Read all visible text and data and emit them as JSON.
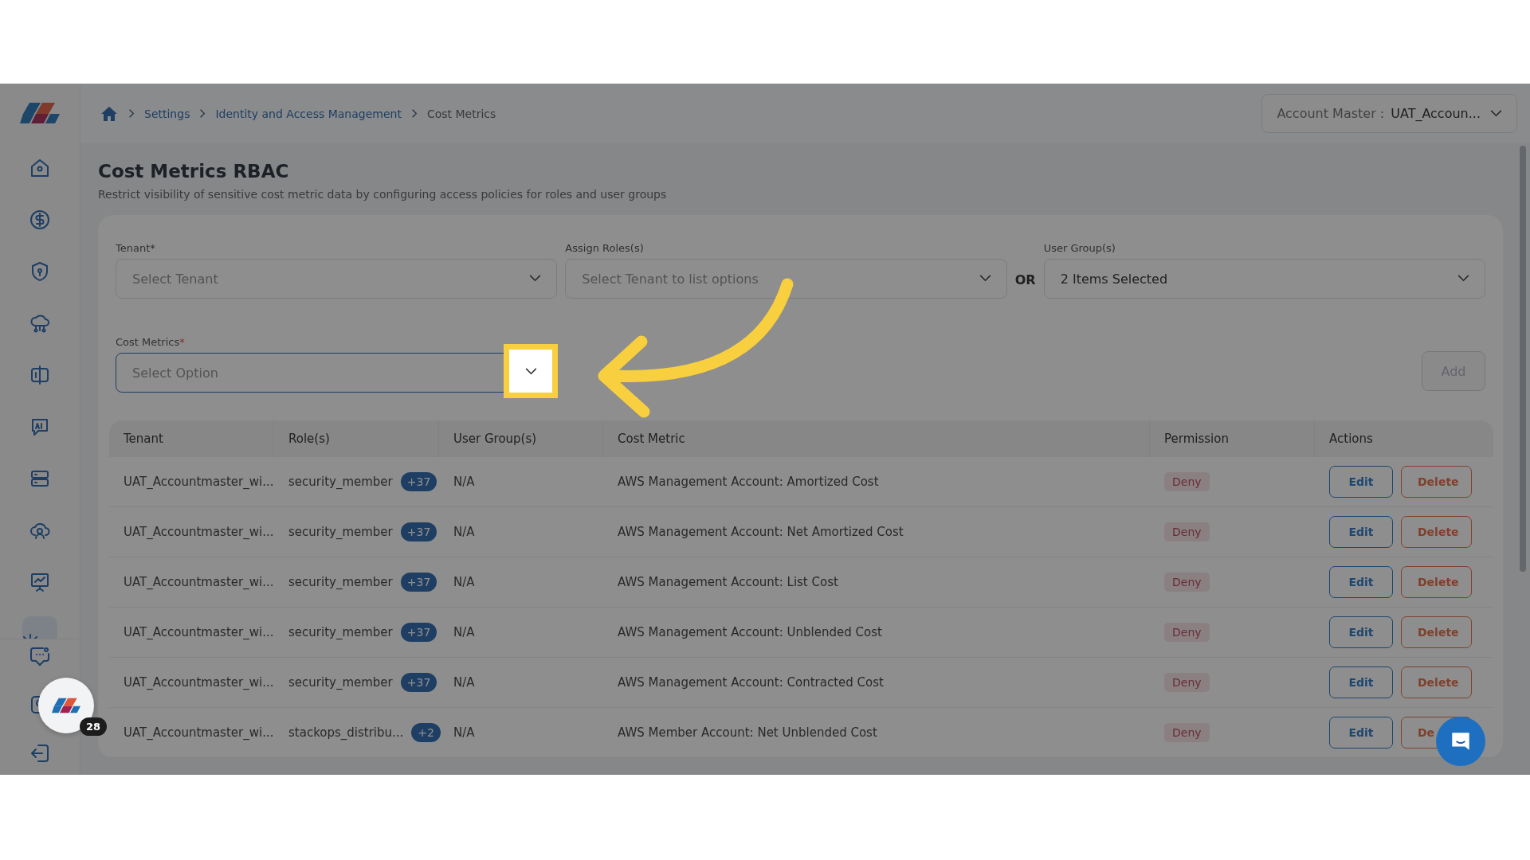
{
  "breadcrumb": [
    {
      "label": "Settings",
      "link": true
    },
    {
      "label": "Identity and Access Management",
      "link": true
    },
    {
      "label": "Cost Metrics",
      "link": false
    }
  ],
  "account": {
    "label": "Account Master :",
    "value": "UAT_Accoun..."
  },
  "sidebar": {
    "items": [
      {
        "selected": false
      },
      {
        "selected": false
      },
      {
        "selected": false
      },
      {
        "selected": false
      },
      {
        "selected": false
      },
      {
        "selected": false
      },
      {
        "selected": false
      },
      {
        "selected": false
      },
      {
        "selected": false
      },
      {
        "selected": true
      }
    ]
  },
  "page": {
    "title": "Cost Metrics RBAC",
    "subtitle": "Restrict visibility of sensitive cost metric data by configuring access policies for roles and user groups"
  },
  "form": {
    "tenant": {
      "label": "Tenant*",
      "placeholder": "Select Tenant"
    },
    "roles": {
      "label": "Assign Roles(s)",
      "placeholder": "Select Tenant to list options"
    },
    "or_label": "OR",
    "user_groups": {
      "label": "User Group(s)",
      "value": "2 Items Selected"
    },
    "cost_metrics": {
      "label": "Cost Metrics",
      "required_mark": "*",
      "placeholder": "Select Option"
    },
    "add_button": {
      "label": "Add",
      "disabled": true
    }
  },
  "table": {
    "columns": [
      "Tenant",
      "Role(s)",
      "User Group(s)",
      "Cost Metric",
      "Permission",
      "Actions"
    ],
    "rows": [
      {
        "tenant": "UAT_Accountmaster_wi...",
        "role": "security_member",
        "role_extra": "+37",
        "user_group": "N/A",
        "cost_metric": "AWS Management Account: Amortized Cost",
        "permission": "Deny",
        "edit": "Edit",
        "delete": "Delete"
      },
      {
        "tenant": "UAT_Accountmaster_wi...",
        "role": "security_member",
        "role_extra": "+37",
        "user_group": "N/A",
        "cost_metric": "AWS Management Account: Net Amortized Cost",
        "permission": "Deny",
        "edit": "Edit",
        "delete": "Delete"
      },
      {
        "tenant": "UAT_Accountmaster_wi...",
        "role": "security_member",
        "role_extra": "+37",
        "user_group": "N/A",
        "cost_metric": "AWS Management Account: List Cost",
        "permission": "Deny",
        "edit": "Edit",
        "delete": "Delete"
      },
      {
        "tenant": "UAT_Accountmaster_wi...",
        "role": "security_member",
        "role_extra": "+37",
        "user_group": "N/A",
        "cost_metric": "AWS Management Account: Unblended Cost",
        "permission": "Deny",
        "edit": "Edit",
        "delete": "Delete"
      },
      {
        "tenant": "UAT_Accountmaster_wi...",
        "role": "security_member",
        "role_extra": "+37",
        "user_group": "N/A",
        "cost_metric": "AWS Management Account: Contracted Cost",
        "permission": "Deny",
        "edit": "Edit",
        "delete": "Delete"
      },
      {
        "tenant": "UAT_Accountmaster_wi...",
        "role": "stackops_distribu...",
        "role_extra": "+2",
        "user_group": "N/A",
        "cost_metric": "AWS Member Account: Net Unblended Cost",
        "permission": "Deny",
        "edit": "Edit",
        "delete": "De"
      }
    ]
  },
  "launcher": {
    "badge": "28"
  }
}
